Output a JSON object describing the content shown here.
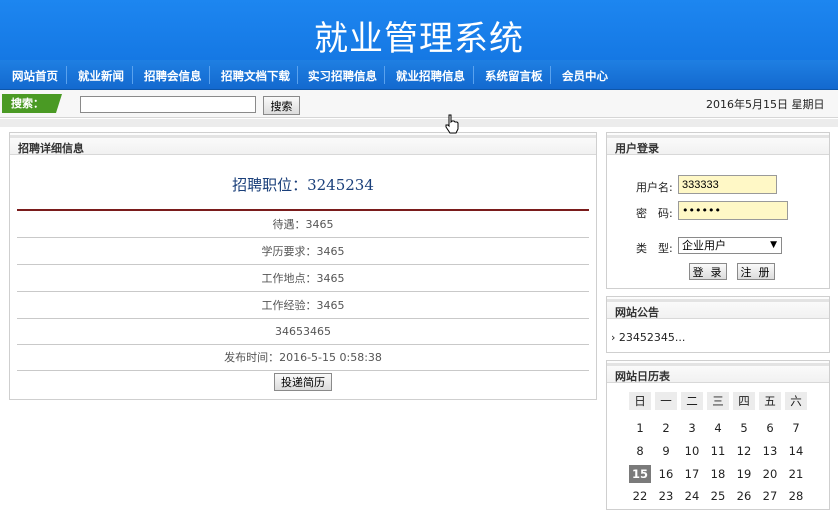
{
  "header": {
    "title": "就业管理系统"
  },
  "nav": {
    "items": [
      "网站首页",
      "就业新闻",
      "招聘会信息",
      "招聘文档下载",
      "实习招聘信息",
      "就业招聘信息",
      "系统留言板",
      "会员中心"
    ]
  },
  "search": {
    "label": "搜索：",
    "input_value": "",
    "button_label": "搜索",
    "date_text": "2016年5月15日 星期日"
  },
  "detail": {
    "panel_title": "招聘详细信息",
    "job_title": "招聘职位：3245234",
    "rows": [
      "待遇：3465",
      "学历要求：3465",
      "工作地点：3465",
      "工作经验：3465",
      "34653465",
      "发布时间：2016-5-15 0:58:38"
    ],
    "apply_button": "投递简历"
  },
  "login": {
    "panel_title": "用户登录",
    "username_label": "用户名:",
    "username_value": "333333",
    "password_label": "密　码:",
    "password_value": "••••••",
    "type_label": "类　型:",
    "type_value": "企业用户",
    "login_button": "登 录",
    "register_button": "注 册"
  },
  "notice": {
    "panel_title": "网站公告",
    "items": [
      "23452345..."
    ]
  },
  "calendar": {
    "panel_title": "网站日历表",
    "weekdays": [
      "日",
      "一",
      "二",
      "三",
      "四",
      "五",
      "六"
    ],
    "weeks": [
      [
        "1",
        "2",
        "3",
        "4",
        "5",
        "6",
        "7"
      ],
      [
        "8",
        "9",
        "10",
        "11",
        "12",
        "13",
        "14"
      ],
      [
        "15",
        "16",
        "17",
        "18",
        "19",
        "20",
        "21"
      ],
      [
        "22",
        "23",
        "24",
        "25",
        "26",
        "27",
        "28"
      ]
    ],
    "today": "15"
  },
  "colors": {
    "header_blue": "#1d86f0",
    "nav_blue": "#1369cf",
    "search_green": "#4a9a24",
    "input_yellow": "#fff8c6",
    "title_rule": "#7a1c1c"
  },
  "icons": {
    "cursor": "hand-pointer-icon",
    "arrow": "triangle-down-icon",
    "bullet": "chevron-right-icon"
  }
}
